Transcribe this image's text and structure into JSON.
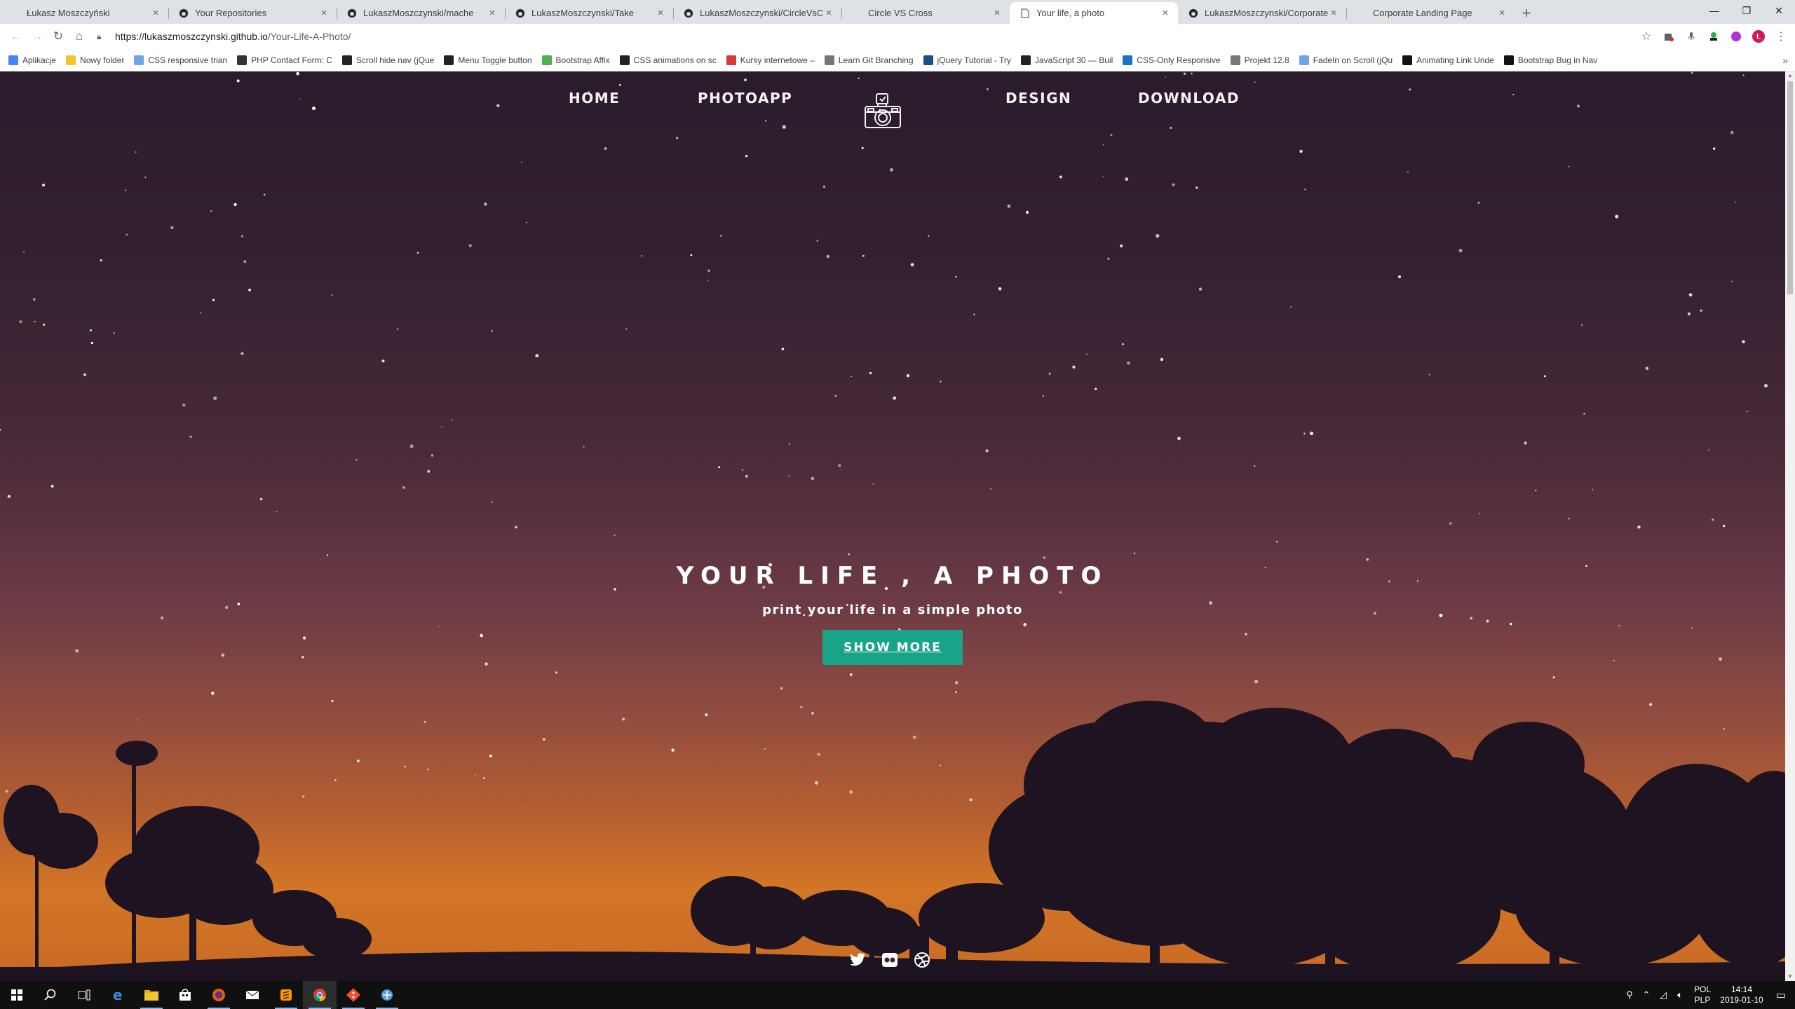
{
  "browser": {
    "tabs": [
      {
        "title": "Łukasz Moszczyński",
        "favicon": "blank-icon"
      },
      {
        "title": "Your Repositories",
        "favicon": "github-icon"
      },
      {
        "title": "LukaszMoszczynski/mache",
        "favicon": "github-icon"
      },
      {
        "title": "LukaszMoszczynski/Take",
        "favicon": "github-icon"
      },
      {
        "title": "LukaszMoszczynski/CircleVsCros",
        "favicon": "github-icon"
      },
      {
        "title": "Circle VS Cross",
        "favicon": "blank-icon"
      },
      {
        "title": "Your life, a photo",
        "favicon": "page-icon",
        "active": true
      },
      {
        "title": "LukaszMoszczynski/Corporate-La",
        "favicon": "github-icon"
      },
      {
        "title": "Corporate Landing Page",
        "favicon": "blank-icon"
      }
    ],
    "url_base": "https://lukaszmoszczynski.github.io",
    "url_path": "/Your-Life-A-Photo/",
    "profile_initial": "Ł",
    "bookmarks": [
      {
        "label": "Aplikacje",
        "icon": "apps-grid-icon",
        "color": "#4285f4"
      },
      {
        "label": "Nowy folder",
        "icon": "folder-icon",
        "color": "#f4c430"
      },
      {
        "label": "CSS responsive trian",
        "icon": "cloud-icon",
        "color": "#6aa6e8"
      },
      {
        "label": "PHP Contact Form: C",
        "icon": "php-icon",
        "color": "#333333"
      },
      {
        "label": "Scroll hide nav (jQue",
        "icon": "codepen-icon",
        "color": "#222222"
      },
      {
        "label": "Menu Toggle button",
        "icon": "codepen-icon",
        "color": "#222222"
      },
      {
        "label": "Bootstrap Affix",
        "icon": "bootstrap-icon",
        "color": "#4caf50"
      },
      {
        "label": "CSS animations on sc",
        "icon": "codepen-icon",
        "color": "#222222"
      },
      {
        "label": "Kursy internetowe –",
        "icon": "udemy-icon",
        "color": "#d9373d"
      },
      {
        "label": "Learn Git Branching",
        "icon": "page-icon",
        "color": "#777777"
      },
      {
        "label": "jQuery Tutorial - Try",
        "icon": "jquery-icon",
        "color": "#1b4e8a"
      },
      {
        "label": "JavaScript 30 — Buil",
        "icon": "js30-icon",
        "color": "#222222"
      },
      {
        "label": "CSS-Only Responsive",
        "icon": "circle-icon",
        "color": "#1b73c8"
      },
      {
        "label": "Projekt 12.8",
        "icon": "page-icon",
        "color": "#777777"
      },
      {
        "label": "FadeIn on Scroll (jQu",
        "icon": "cloud-icon",
        "color": "#6aa6e8"
      },
      {
        "label": "Animating Link Unde",
        "icon": "tricks-icon",
        "color": "#111111"
      },
      {
        "label": "Bootstrap Bug in Nav",
        "icon": "b-icon",
        "color": "#111111"
      }
    ]
  },
  "site": {
    "nav": {
      "home": "HOME",
      "photoapp": "PHOTOAPP",
      "design": "DESIGN",
      "download": "DOWNLOAD",
      "logo_icon": "vintage-camera-icon"
    },
    "hero": {
      "title": "YOUR LIFE , A PHOTO",
      "subtitle": "print your life in a simple photo",
      "button": "SHOW MORE",
      "button_color": "#17a489"
    },
    "social": [
      "twitter-icon",
      "flickr-icon",
      "dribbble-icon"
    ]
  },
  "taskbar": {
    "apps": [
      "windows-start-icon",
      "search-icon",
      "task-view-icon",
      "edge-icon",
      "file-explorer-icon",
      "store-icon",
      "firefox-icon",
      "mail-icon",
      "sublime-icon",
      "chrome-icon",
      "git-icon",
      "app-icon"
    ],
    "lang_top": "POL",
    "lang_bottom": "PLP",
    "time": "14:14",
    "date": "2019-01-10"
  }
}
